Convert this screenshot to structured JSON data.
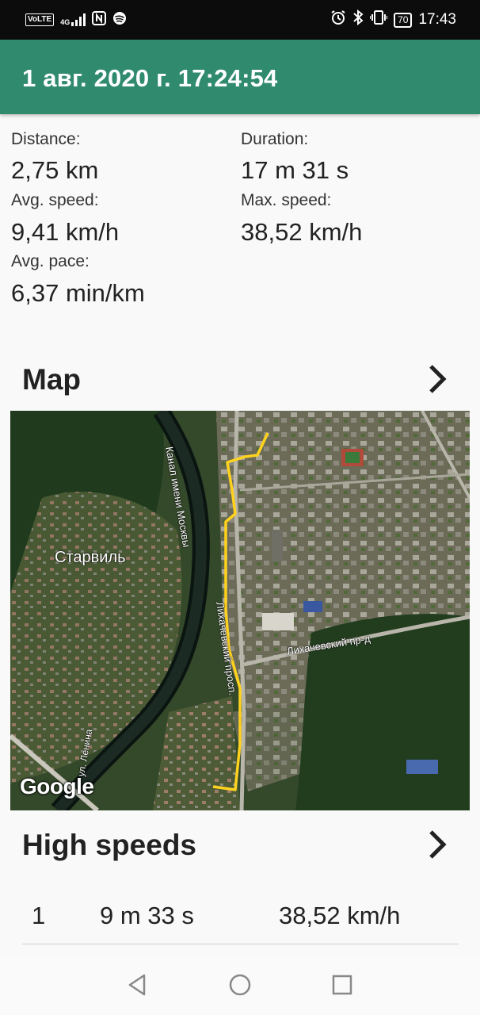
{
  "status_bar": {
    "volte": "VoLTE",
    "network": "4G",
    "battery": "70",
    "time": "17:43",
    "left_icons": [
      "volte-icon",
      "signal-icon",
      "nfc-icon",
      "spotify-icon"
    ],
    "right_icons": [
      "alarm-icon",
      "bluetooth-icon",
      "vibrate-icon",
      "battery-icon"
    ]
  },
  "app_bar": {
    "title": "1 авг. 2020 г. 17:24:54",
    "color": "#2f8a6e"
  },
  "stats": {
    "distance_label": "Distance:",
    "distance_value": "2,75 km",
    "duration_label": "Duration:",
    "duration_value": "17 m 31 s",
    "avg_speed_label": "Avg. speed:",
    "avg_speed_value": "9,41 km/h",
    "max_speed_label": "Max. speed:",
    "max_speed_value": "38,52 km/h",
    "avg_pace_label": "Avg. pace:",
    "avg_pace_value": "6,37 min/km"
  },
  "map_section": {
    "title": "Map",
    "labels": {
      "village": "Старвиль",
      "canal": "Канал имени Москвы",
      "prospect": "Лихачевский просп.",
      "passage": "Лихачевский пр-д",
      "lenina": "ул. Ленина"
    },
    "google": "Google",
    "route_color": "#ffd21e"
  },
  "high_speeds": {
    "title": "High speeds",
    "rows": [
      {
        "index": "1",
        "time": "9 m 33 s",
        "speed": "38,52 km/h"
      }
    ]
  },
  "nav": {
    "icons": [
      "back-icon",
      "home-icon",
      "recents-icon"
    ]
  }
}
